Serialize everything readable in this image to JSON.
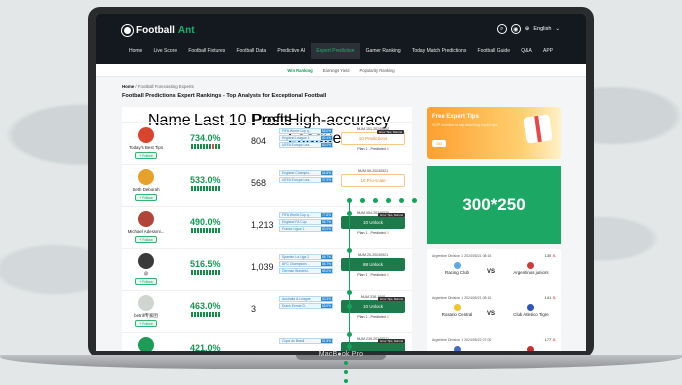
{
  "brand": {
    "part1": "Football",
    "part2": "Ant"
  },
  "header": {
    "language": "English"
  },
  "nav": [
    "Home",
    "Live Score",
    "Football Fixtures",
    "Football Data",
    "Predictive AI",
    "Expert Prediction",
    "Gamer Ranking",
    "Today Match Predictions",
    "Football Guide",
    "Q&A",
    "APP"
  ],
  "nav_active": 5,
  "subnav": [
    "Win Ranking",
    "Earnings Yield",
    "Popularity Ranking"
  ],
  "breadcrumb": {
    "home": "Home",
    "sep": " / ",
    "current": "Football Forecasting Experts"
  },
  "page_title": "Football Predictions Expert Rankings - Top Analysts for Exceptional Football",
  "table": {
    "headers": {
      "name": "Name",
      "profit": "Last 10 Profit",
      "posts": "Posts",
      "leagues": "High-accuracy League"
    },
    "follow_label": "+ Follow",
    "rows": [
      {
        "name": "Today's Best Tips",
        "profit": "734.0%",
        "posts": "804",
        "avatar": "#d8442e",
        "leagues": [
          {
            "n": "FIFA World Cup q..",
            "p": "85.0%"
          },
          {
            "n": "England League 1",
            "p": "82.4%"
          },
          {
            "n": "UEFA Europa Lea..",
            "p": "80.0%"
          }
        ],
        "tip": {
          "num": "NUM.101-20240502",
          "label": "10 Predictions",
          "style": "light",
          "tag": "Error Tips, Refund",
          "plan": "Plan 1 , Predicted ",
          "planv": "6"
        },
        "bars": "gggggggrgg"
      },
      {
        "name": "Seth Deborah",
        "profit": "533.0%",
        "posts": "568",
        "avatar": "#e7a12b",
        "leagues": [
          {
            "n": "England Champio..",
            "p": "64.8%"
          },
          {
            "n": "UEFA Europa Lea..",
            "p": "57.9%"
          }
        ],
        "tip": {
          "num": "NUM.59-20240521",
          "label": "10 Pro-scale",
          "style": "light",
          "tag": "",
          "plan": "",
          "planv": ""
        },
        "bars": "gggggggggg"
      },
      {
        "name": "Michael Adessmi...",
        "profit": "490.0%",
        "posts": "1,213",
        "avatar": "#b2453a",
        "leagues": [
          {
            "n": "FIFA World Cup q..",
            "p": "77.8%"
          },
          {
            "n": "England FA Cup",
            "p": "66.7%"
          },
          {
            "n": "France Ligue 1",
            "p": "60.0%"
          }
        ],
        "tip": {
          "num": "NUM.054-20240520",
          "label": "10 Unlock",
          "style": "dark",
          "tag": "Error Tips, Refund",
          "plan": "Plan 1 , Predicted ",
          "planv": "0"
        },
        "bars": "gggggggggg"
      },
      {
        "name": "@",
        "profit": "516.5%",
        "posts": "1,039",
        "avatar": "#3a3a3a",
        "leagues": [
          {
            "n": "Spanish La Liga 2",
            "p": "66.7%"
          },
          {
            "n": "AFC Champions ..",
            "p": "66.7%"
          },
          {
            "n": "German Bundesl..",
            "p": "65.0%"
          }
        ],
        "tip": {
          "num": "NUM.20-20240521",
          "label": "88 Unlock",
          "style": "dark",
          "tag": "",
          "plan": "Plan 1 , Predicted ",
          "planv": "0"
        },
        "bars": "gggggggggg"
      },
      {
        "name": "betrill专家团",
        "profit": "463.0%",
        "posts": "3",
        "avatar": "#cfd6cf",
        "leagues": [
          {
            "n": "Australia A-League",
            "p": "83.3%"
          },
          {
            "n": "Dutch Eerste D..",
            "p": "65.0%"
          }
        ],
        "tip": {
          "num": "NUM.338-1040",
          "label": "10 Unlock",
          "style": "dark",
          "tag": "Error Tips, Refund",
          "plan": "Plan 1 , Predicted ",
          "planv": "0"
        },
        "bars": "gggggggggg"
      },
      {
        "name": "",
        "profit": "421.0%",
        "posts": "",
        "avatar": "#1c9c56",
        "leagues": [
          {
            "n": "Copa do Brasil",
            "p": "81.8%"
          }
        ],
        "tip": {
          "num": "NUM.239-20240521",
          "label": "",
          "style": "dark",
          "tag": "Error Tips, Refund",
          "plan": "",
          "planv": ""
        },
        "bars": "gggggggggg"
      }
    ]
  },
  "promo": {
    "title": "Free Expert Tips",
    "sub": "SVIP member in top-attaching expert tips",
    "button": "GO"
  },
  "ad": {
    "label": "300*250"
  },
  "matches": [
    {
      "meta": "Argentine Division 1 2024/05/21 08:15",
      "count": "130",
      "home": "Racing Club",
      "away": "Argentinos juniors",
      "hc": "#5fa8e3",
      "ac": "#d23a3a"
    },
    {
      "meta": "Argentine Division 1 2024/05/21 08:15",
      "count": "141",
      "home": "Rosario Central",
      "away": "Club Atletico Tigre",
      "hc": "#f0c22c",
      "ac": "#2f55b7"
    },
    {
      "meta": "Argentine Division 1 2024/05/22 07:00",
      "count": "177",
      "home": "Velez Sarsfield",
      "away": "Newells Old Boys",
      "hc": "#4169c7",
      "ac": "#c92e2e"
    }
  ],
  "vs_label": "VS",
  "laptop_label": {
    "a": "MacB",
    "b": "ok Pro"
  }
}
